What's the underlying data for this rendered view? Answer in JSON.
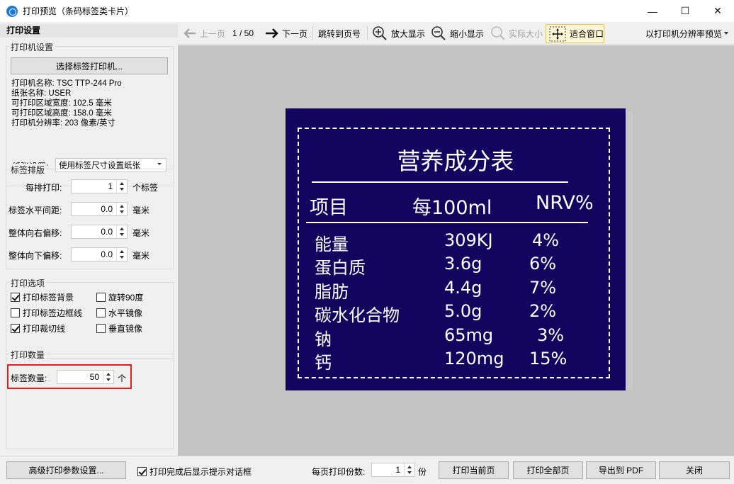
{
  "window": {
    "title": "打印预览（条码标签类卡片）",
    "minimize": "—",
    "maximize": "☐",
    "close": "✕"
  },
  "left_panel": {
    "header": "打印设置",
    "printer_group": {
      "title": "打印机设置",
      "select_button": "选择标签打印机...",
      "info": [
        "打印机名称: TSC TTP-244 Pro",
        "纸张名称: USER",
        "可打印区域宽度: 102.5 毫米",
        "可打印区域高度: 158.0 毫米",
        "打印机分辨率: 203 像素/英寸"
      ],
      "paper_label": "纸张设置:",
      "paper_value": "使用标签尺寸设置纸张"
    },
    "layout_group": {
      "title": "标签排版",
      "rows": [
        {
          "label": "每排打印:",
          "value": "1",
          "unit": "个标签"
        },
        {
          "label": "标签水平间距:",
          "value": "0.0",
          "unit": "毫米"
        },
        {
          "label": "整体向右偏移:",
          "value": "0.0",
          "unit": "毫米"
        },
        {
          "label": "整体向下偏移:",
          "value": "0.0",
          "unit": "毫米"
        }
      ]
    },
    "options_group": {
      "title": "打印选项",
      "options": [
        {
          "label": "打印标签背景",
          "checked": true
        },
        {
          "label": "旋转90度",
          "checked": false
        },
        {
          "label": "打印标签边框线",
          "checked": false
        },
        {
          "label": "水平镜像",
          "checked": false
        },
        {
          "label": "打印裁切线",
          "checked": true
        },
        {
          "label": "垂直镜像",
          "checked": false
        }
      ]
    },
    "quantity_group": {
      "title": "打印数量",
      "label": "标签数量:",
      "value": "50",
      "unit": "个"
    }
  },
  "toolbar": {
    "prev": "上一页",
    "page": "1 / 50",
    "next": "下一页",
    "jump": "跳转到页号",
    "zoom_in": "放大显示",
    "zoom_out": "缩小显示",
    "actual": "实际大小",
    "fit": "适合窗口",
    "resolution": "以打印机分辨率预览"
  },
  "label": {
    "title": "营养成分表",
    "headers": [
      "项目",
      "每100ml",
      "NRV%"
    ],
    "rows": [
      {
        "item": "能量",
        "amount": "309KJ",
        "nrv": "4%"
      },
      {
        "item": "蛋白质",
        "amount": "3.6g",
        "nrv": "6%"
      },
      {
        "item": "脂肪",
        "amount": "4.4g",
        "nrv": "7%"
      },
      {
        "item": "碳水化合物",
        "amount": "5.0g",
        "nrv": "2%"
      },
      {
        "item": "钠",
        "amount": "65mg",
        "nrv": "3%"
      },
      {
        "item": "钙",
        "amount": "120mg",
        "nrv": "15%"
      }
    ],
    "background_color": "#12035f"
  },
  "bottom": {
    "advanced": "高级打印参数设置...",
    "show_dialog": "打印完成后显示提示对话框",
    "show_dialog_checked": true,
    "copies_label": "每页打印份数:",
    "copies_value": "1",
    "copies_unit": "份",
    "print_current": "打印当前页",
    "print_all": "打印全部页",
    "export_pdf": "导出到 PDF",
    "close": "关闭"
  }
}
